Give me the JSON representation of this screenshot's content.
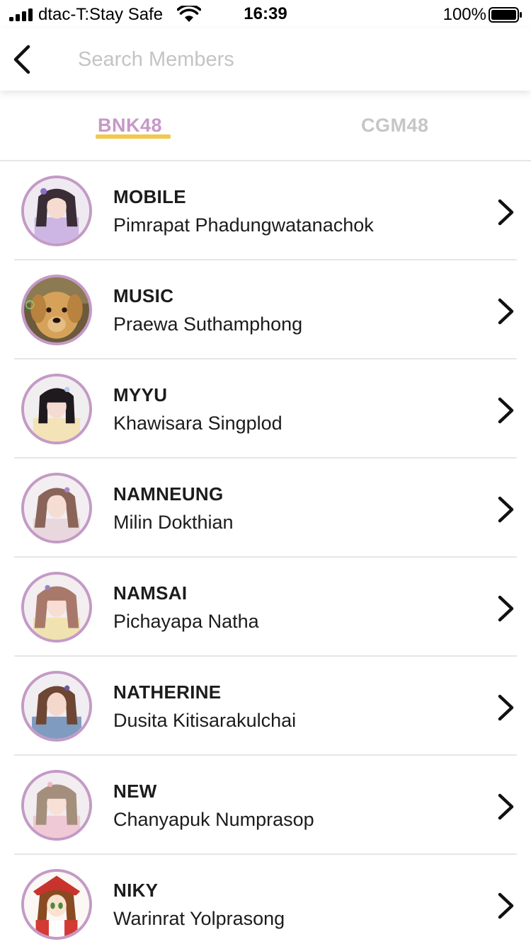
{
  "status_bar": {
    "carrier": "dtac-T:Stay Safe",
    "time": "16:39",
    "battery_percent": "100%"
  },
  "search": {
    "placeholder": "Search Members"
  },
  "tabs": [
    {
      "label": "BNK48",
      "active": true
    },
    {
      "label": "CGM48",
      "active": false
    }
  ],
  "colors": {
    "accent": "#c698c8",
    "tab_underline": "#f1c94f",
    "avatar_border": "#c49ac6",
    "inactive_tab": "#c6c6c6"
  },
  "members": [
    {
      "nickname": "MOBILE",
      "name": "Pimrapat Phadungwatanachok"
    },
    {
      "nickname": "MUSIC",
      "name": "Praewa Suthamphong"
    },
    {
      "nickname": "MYYU",
      "name": "Khawisara Singplod"
    },
    {
      "nickname": "NAMNEUNG",
      "name": "Milin Dokthian"
    },
    {
      "nickname": "NAMSAI",
      "name": "Pichayapa Natha"
    },
    {
      "nickname": "NATHERINE",
      "name": "Dusita Kitisarakulchai"
    },
    {
      "nickname": "NEW",
      "name": "Chanyapuk Numprasop"
    },
    {
      "nickname": "NIKY",
      "name": "Warinrat Yolprasong"
    }
  ]
}
